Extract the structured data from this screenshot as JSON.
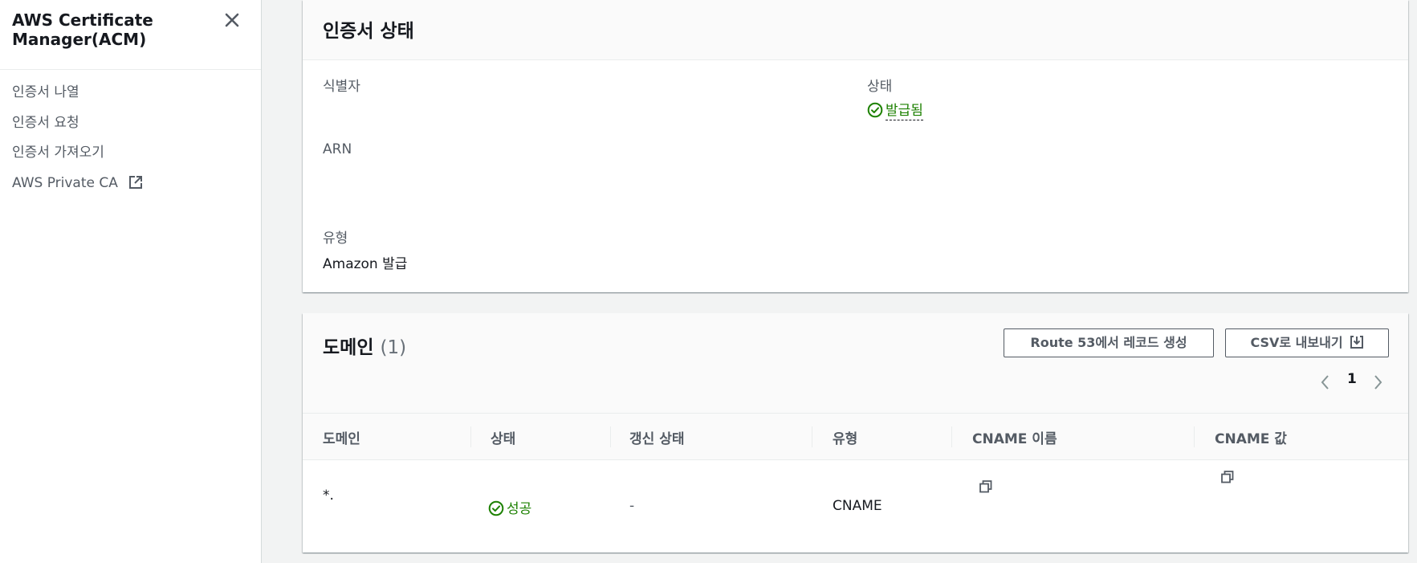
{
  "sidebar": {
    "title": "AWS Certificate Manager(ACM)",
    "close_icon": "close-icon",
    "items": [
      {
        "label": "인증서 나열"
      },
      {
        "label": "인증서 요청"
      },
      {
        "label": "인증서 가져오기"
      },
      {
        "label": "AWS Private CA",
        "icon": "external-link-icon"
      }
    ]
  },
  "certificate_status": {
    "title": "인증서 상태",
    "identifier_label": "식별자",
    "identifier_value": "",
    "status_label": "상태",
    "status_value": "발급됨",
    "arn_label": "ARN",
    "arn_value": "",
    "type_label": "유형",
    "type_value": "Amazon 발급"
  },
  "domains": {
    "title": "도메인",
    "count": "(1)",
    "buttons": {
      "route53": "Route 53에서 레코드 생성",
      "export_csv": "CSV로 내보내기"
    },
    "pagination": {
      "current_page": "1"
    },
    "columns": [
      "도메인",
      "상태",
      "갱신 상태",
      "유형",
      "CNAME 이름",
      "CNAME 값"
    ],
    "rows": [
      {
        "domain": "*.",
        "status": "성공",
        "renewal_status": "-",
        "type": "CNAME",
        "cname_name": "",
        "cname_value": ""
      }
    ]
  },
  "colors": {
    "success": "#1d8102",
    "text_primary": "#16191f",
    "text_secondary": "#545b64",
    "background": "#f2f3f3"
  }
}
